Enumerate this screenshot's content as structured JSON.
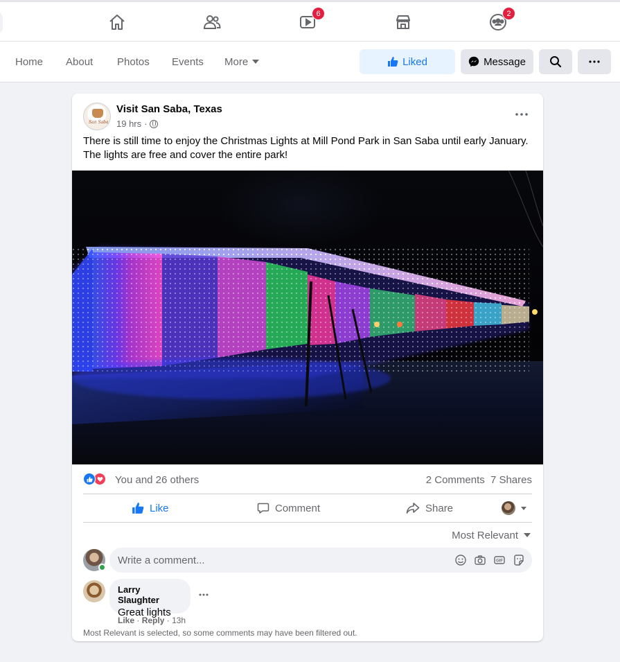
{
  "topnav": {
    "items": [
      {
        "icon": "home-icon"
      },
      {
        "icon": "friends-icon"
      },
      {
        "icon": "watch-icon",
        "badge": "6"
      },
      {
        "icon": "marketplace-icon"
      },
      {
        "icon": "groups-icon",
        "badge": "2"
      }
    ]
  },
  "page_tabs": {
    "home": "Home",
    "about": "About",
    "photos": "Photos",
    "events": "Events",
    "more": "More",
    "liked": "Liked",
    "message": "Message"
  },
  "post": {
    "page_name": "Visit San Saba, Texas",
    "avatar_text": "San Saba",
    "time": "19 hrs",
    "meta_sep": "·",
    "text": "There is still time to enjoy the Christmas Lights at Mill Pond Park in San Saba until early January. The lights are free and cover the entire park!",
    "reactions": {
      "summary": "You and 26 others",
      "comments": "2 Comments",
      "shares": "7 Shares"
    },
    "actions": {
      "like": "Like",
      "comment": "Comment",
      "share": "Share"
    },
    "sort": "Most Relevant",
    "comment_placeholder": "Write a comment...",
    "comments": [
      {
        "author": "Larry Slaughter",
        "text": "Great lights",
        "like": "Like",
        "reply": "Reply",
        "time": "13h"
      }
    ],
    "filter_note": "Most Relevant is selected, so some comments may have been filtered out."
  },
  "colors": {
    "accent": "#1877f2",
    "badge": "#e41e3f",
    "love": "#f33e58",
    "online": "#31a24c"
  }
}
